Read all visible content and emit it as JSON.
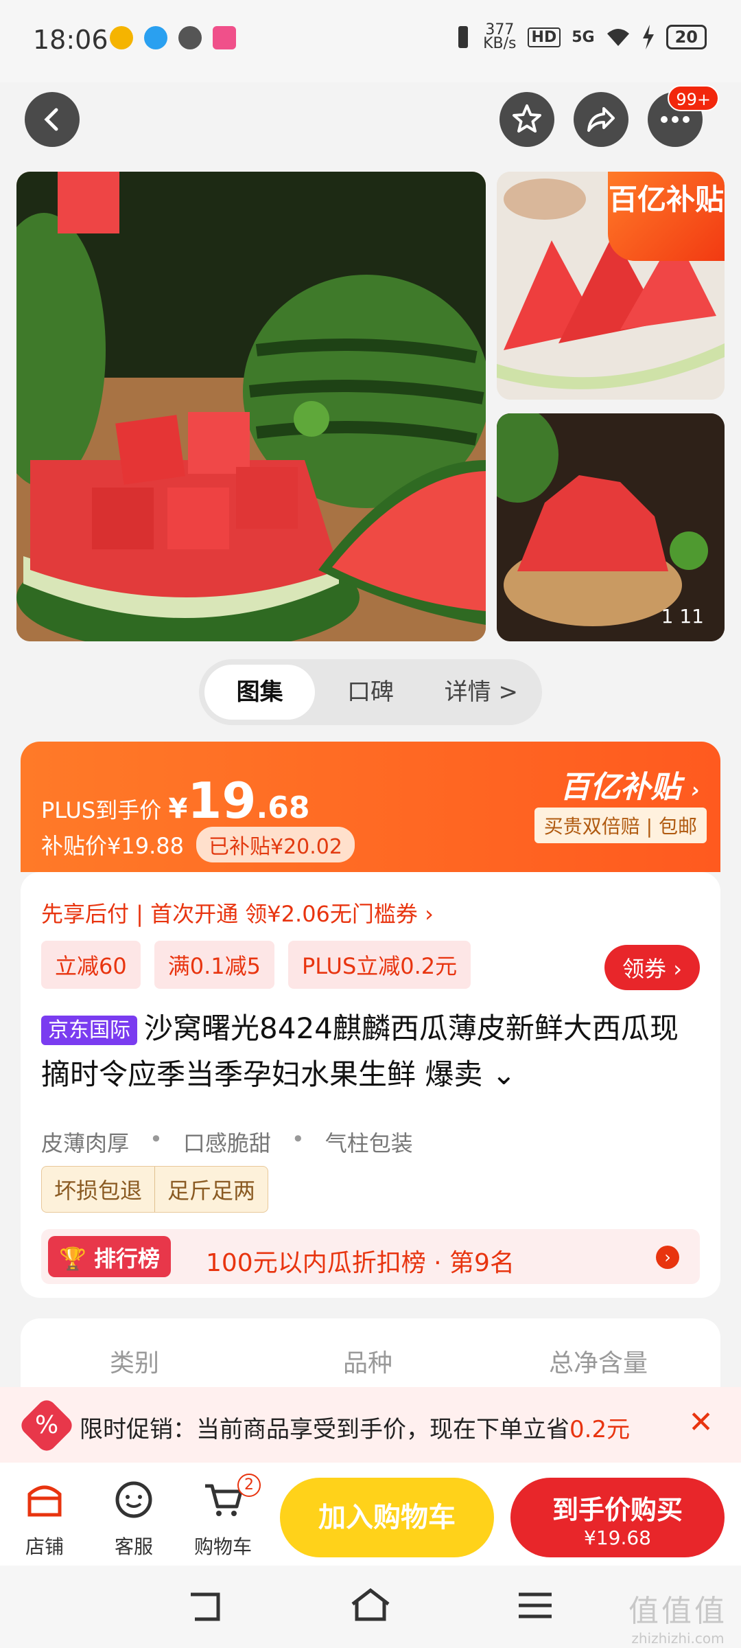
{
  "status_bar": {
    "time": "18:06",
    "net_speed_value": "377",
    "net_speed_unit": "KB/s",
    "signal": "5G",
    "hd": "HD",
    "battery": "20"
  },
  "top_nav": {
    "badge": "99+"
  },
  "gallery": {
    "subsidy_tag": "百亿补贴",
    "counter": "1  11"
  },
  "tabs": [
    "图集",
    "口碑",
    "详情 >"
  ],
  "price": {
    "label": "PLUS到手价",
    "currency": "¥",
    "int": "19",
    "dec": ".68",
    "subsidy_price": "补贴价¥19.88",
    "subsidized": "已补贴¥20.02",
    "logo": "百亿补贴",
    "guarantee": "买贵双倍赔 | 包邮"
  },
  "info": {
    "pay_later": "先享后付 | 首次开通 领¥2.06无门槛券 ›",
    "chips": [
      "立减60",
      "满0.1减5",
      "PLUS立减0.2元"
    ],
    "coupon_btn": "领券 ›",
    "jd_tag": "京东国际",
    "title": "沙窝曙光8424麒麟西瓜薄皮新鲜大西瓜现摘时令应季当季孕妇水果生鲜 爆卖 ⌄",
    "features": [
      "皮薄肉厚",
      "•",
      "口感脆甜",
      "•",
      "气柱包装"
    ],
    "services": [
      "坏损包退",
      "足斤足两"
    ],
    "rank_label": "排行榜",
    "rank_text": "100元以内瓜折扣榜 · 第9名"
  },
  "specs": [
    "类别",
    "品种",
    "总净含量"
  ],
  "promo": {
    "icon": "%",
    "text": "限时促销：当前商品享受到手价，现在下单立省",
    "amount": "0.2元",
    "close": "✕"
  },
  "bottom": {
    "shop": "店铺",
    "service": "客服",
    "cart": "购物车",
    "cart_count": "2",
    "add_cart": "加入购物车",
    "buy_now": "到手价购买",
    "buy_price": "¥19.68"
  },
  "watermark": {
    "cn": "值值值",
    "en": "zhizhizhi.com"
  }
}
